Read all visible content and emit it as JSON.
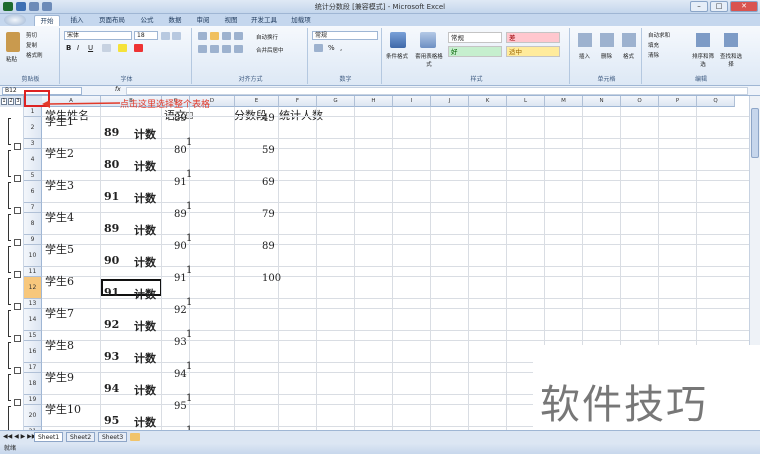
{
  "window": {
    "title": "统计分数段 [兼容模式] - Microsoft Excel",
    "minimize": "–",
    "maximize": "□",
    "close": "✕"
  },
  "tabs": [
    "开始",
    "插入",
    "页面布局",
    "公式",
    "数据",
    "审阅",
    "视图",
    "开发工具",
    "加载项"
  ],
  "ribbon": {
    "clipboard": {
      "label": "剪贴板",
      "paste": "粘贴",
      "cut": "剪切",
      "copy": "复制",
      "format_painter": "格式刷"
    },
    "font": {
      "label": "字体",
      "name": "宋体",
      "size": "18",
      "bold": "B",
      "italic": "I",
      "underline": "U"
    },
    "alignment": {
      "label": "对齐方式",
      "wrap": "自动换行",
      "merge": "合并后居中"
    },
    "number": {
      "label": "数字",
      "format": "常规",
      "percent": "%",
      "comma": ","
    },
    "styles": {
      "label": "样式",
      "conditional": "条件格式",
      "table": "套用表格格式",
      "normal": "常规",
      "bad": "差",
      "good": "好",
      "neutral": "适中"
    },
    "cells": {
      "label": "单元格",
      "insert": "插入",
      "delete": "删除",
      "format": "格式"
    },
    "editing": {
      "label": "编辑",
      "autosum": "自动求和",
      "fill": "填充",
      "clear": "清除",
      "sort": "排序和筛选",
      "find": "查找和选择"
    }
  },
  "formula_bar": {
    "name_box": "B12",
    "fx": "fx"
  },
  "outline_levels": [
    "1",
    "2",
    "3"
  ],
  "columns": [
    "A",
    "B",
    "C",
    "D",
    "E",
    "F",
    "G",
    "H",
    "I",
    "J",
    "K",
    "L",
    "M",
    "N",
    "O",
    "P",
    "Q"
  ],
  "rows": [
    "1",
    "2",
    "3",
    "4",
    "5",
    "6",
    "7",
    "8",
    "9",
    "10",
    "11",
    "12",
    "13",
    "14",
    "15",
    "16",
    "17",
    "18",
    "19",
    "20",
    "21"
  ],
  "selected_row": "12",
  "cells": {
    "header": {
      "name": "学生姓名",
      "subject": "语文",
      "range": "分数段",
      "count": "统计人数"
    },
    "students": [
      {
        "name": "学生1",
        "score": "89",
        "subtotal_value": "89",
        "subtotal_label": "计数",
        "count": "1",
        "range": "49"
      },
      {
        "name": "学生2",
        "score": "80",
        "subtotal_value": "80",
        "subtotal_label": "计数",
        "count": "1",
        "range": "59"
      },
      {
        "name": "学生3",
        "score": "91",
        "subtotal_value": "91",
        "subtotal_label": "计数",
        "count": "1",
        "range": "69"
      },
      {
        "name": "学生4",
        "score": "89",
        "subtotal_value": "89",
        "subtotal_label": "计数",
        "count": "1",
        "range": "79"
      },
      {
        "name": "学生5",
        "score": "90",
        "subtotal_value": "90",
        "subtotal_label": "计数",
        "count": "1",
        "range": "89"
      },
      {
        "name": "学生6",
        "score": "91",
        "subtotal_value": "91",
        "subtotal_label": "计数",
        "count": "1",
        "range": "100"
      },
      {
        "name": "学生7",
        "score": "92",
        "subtotal_value": "92",
        "subtotal_label": "计数",
        "count": "1",
        "range": ""
      },
      {
        "name": "学生8",
        "score": "93",
        "subtotal_value": "93",
        "subtotal_label": "计数",
        "count": "1",
        "range": ""
      },
      {
        "name": "学生9",
        "score": "94",
        "subtotal_value": "94",
        "subtotal_label": "计数",
        "count": "1",
        "range": ""
      },
      {
        "name": "学生10",
        "score": "95",
        "subtotal_value": "95",
        "subtotal_label": "计数",
        "count": "1",
        "range": ""
      }
    ]
  },
  "annotation": "点击这里选择整个表格",
  "sheets": [
    "Sheet1",
    "Sheet2",
    "Sheet3"
  ],
  "status": "就绪",
  "watermark": "软件技巧"
}
